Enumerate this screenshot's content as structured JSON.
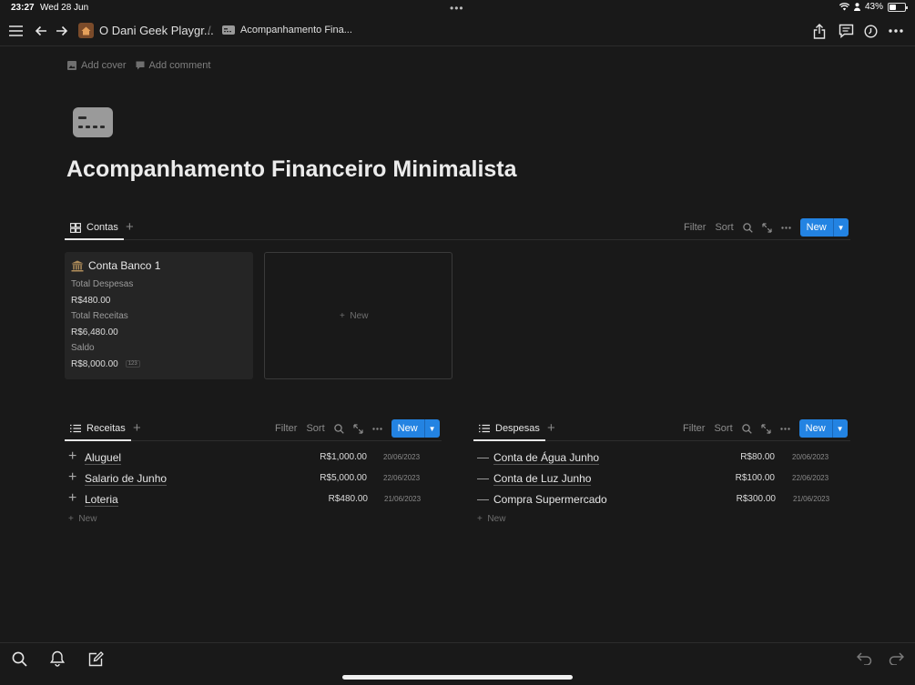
{
  "status_bar": {
    "time": "23:27",
    "date": "Wed 28 Jun",
    "battery_percent": "43%",
    "battery_level": 0.43
  },
  "topbar": {
    "workspace": "O Dani Geek Playgr...",
    "separator": "/",
    "page": "Acompanhamento Fina..."
  },
  "page_actions": {
    "add_cover": "Add cover",
    "add_comment": "Add comment"
  },
  "page_title": "Acompanhamento Financeiro Minimalista",
  "contas": {
    "tab_label": "Contas",
    "filter": "Filter",
    "sort": "Sort",
    "new": "New",
    "card": {
      "title": "Conta Banco 1",
      "props": [
        {
          "label": "Total Despesas",
          "value": "R$480.00"
        },
        {
          "label": "Total Receitas",
          "value": "R$6,480.00"
        },
        {
          "label": "Saldo",
          "value": "R$8,000.00"
        }
      ],
      "number_tag": "123"
    },
    "new_card": "New"
  },
  "receitas": {
    "tab_label": "Receitas",
    "filter": "Filter",
    "sort": "Sort",
    "new": "New",
    "rows": [
      {
        "name": "Aluguel",
        "amount": "R$1,000.00",
        "date": "20/06/2023"
      },
      {
        "name": "Salario de Junho",
        "amount": "R$5,000.00",
        "date": "22/06/2023"
      },
      {
        "name": "Loteria",
        "amount": "R$480.00",
        "date": "21/06/2023"
      }
    ],
    "new_row": "New"
  },
  "despesas": {
    "tab_label": "Despesas",
    "filter": "Filter",
    "sort": "Sort",
    "new": "New",
    "rows": [
      {
        "name": "Conta de Água Junho",
        "amount": "R$80.00",
        "date": "20/06/2023"
      },
      {
        "name": "Conta de Luz Junho",
        "amount": "R$100.00",
        "date": "22/06/2023"
      },
      {
        "name": "Compra Supermercado",
        "amount": "R$300.00",
        "date": "21/06/2023"
      }
    ],
    "new_row": "New"
  },
  "colors": {
    "background": "#191919",
    "accent": "#2383e2",
    "card": "#252525"
  }
}
